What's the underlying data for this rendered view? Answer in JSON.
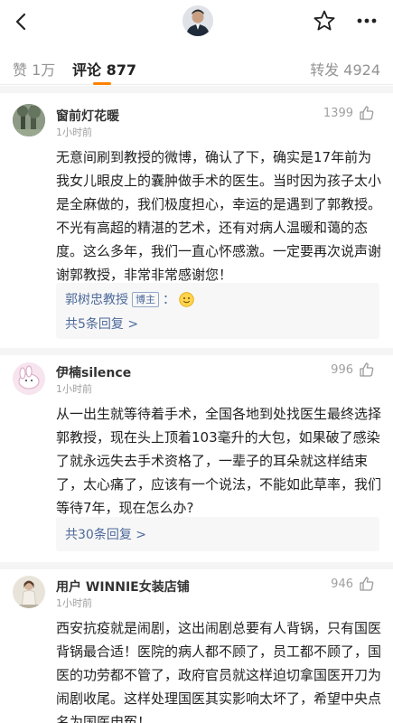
{
  "header": {
    "back_icon": "back-chevron-icon",
    "star_icon": "star-outline-icon",
    "more_icon": "more-dots-icon"
  },
  "tabs": {
    "like": "赞 1万",
    "comment": "评论 877",
    "repost": "转发 4924",
    "accent": "#ff8200"
  },
  "comments": [
    {
      "name": "窗前灯花暖",
      "time": "1小时前",
      "likes": "1399",
      "text": "无意间刷到教授的微博，确认了下，确实是17年前为我女儿眼皮上的囊肿做手术的医生。当时因为孩子太小是全麻做的，我们极度担心，幸运的是遇到了郭教授。不光有高超的精湛的艺术，还有对病人温暖和蔼的态度。这么多年，我们一直心怀感激。一定要再次说声谢谢郭教授，非常非常感谢您！",
      "reply_author": "郭树忠教授",
      "reply_badge": "博主",
      "reply_sep": "：",
      "more_replies": "共5条回复 >"
    },
    {
      "name": "伊楠silence",
      "time": "1小时前",
      "likes": "996",
      "text": "从一出生就等待着手术，全国各地到处找医生最终选择郭教授，现在头上顶着103毫升的大包，如果破了感染了就永远失去手术资格了，一辈子的耳朵就这样结束了，太心痛了，应该有一个说法，不能如此草率，我们等待7年，现在怎么办?",
      "more_replies": "共30条回复 >"
    },
    {
      "name": "用户 WINNIE女装店铺",
      "time": "1小时前",
      "likes": "946",
      "text": "西安抗疫就是闹剧，这出闹剧总要有人背锅，只有国医背锅最合适！医院的病人都不顾了，员工都不顾了，国医的功劳都不管了，政府官员就这样迫切拿国医开刀为闹剧收尾。这样处理国医其实影响太坏了，希望中央点名为国医申冤！"
    }
  ],
  "colors": {
    "link_blue": "#4e6a9b",
    "meta_gray": "#a0a0a0"
  }
}
